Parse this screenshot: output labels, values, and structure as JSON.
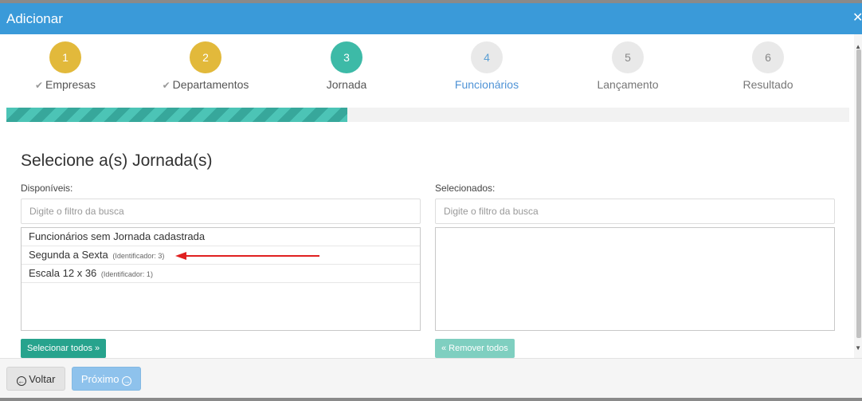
{
  "modal": {
    "title": "Adicionar",
    "close_glyph": "✕"
  },
  "stepper": {
    "steps": [
      {
        "number": "1",
        "label": "Empresas",
        "state": "done"
      },
      {
        "number": "2",
        "label": "Departamentos",
        "state": "done"
      },
      {
        "number": "3",
        "label": "Jornada",
        "state": "current"
      },
      {
        "number": "4",
        "label": "Funcionários",
        "state": "next"
      },
      {
        "number": "5",
        "label": "Lançamento",
        "state": "pending"
      },
      {
        "number": "6",
        "label": "Resultado",
        "state": "pending"
      }
    ],
    "progress_percent": 40.5
  },
  "section": {
    "title": "Selecione a(s) Jornada(s)"
  },
  "available": {
    "label": "Disponíveis:",
    "filter_placeholder": "Digite o filtro da busca",
    "items": [
      {
        "name": "Funcionários sem Jornada cadastrada",
        "meta": ""
      },
      {
        "name": "Segunda a Sexta",
        "meta": "(Identificador: 3)"
      },
      {
        "name": "Escala 12 x 36",
        "meta": "(Identificador: 1)"
      }
    ],
    "select_all_label": "Selecionar todos »"
  },
  "selected": {
    "label": "Selecionados:",
    "filter_placeholder": "Digite o filtro da busca",
    "remove_all_label": "« Remover todos"
  },
  "footer": {
    "back_label": "Voltar",
    "next_label": "Próximo"
  },
  "icons": {
    "check": "check-icon",
    "arrow_left_circle": "arrow-left-circle-icon",
    "arrow_right_circle": "arrow-right-circle-icon",
    "close": "close-icon"
  },
  "colors": {
    "header": "#3a9ad9",
    "step_done": "#e2b93b",
    "step_current": "#3dbaa7",
    "progress": "#37a79b",
    "annotation_arrow": "#e02020"
  }
}
